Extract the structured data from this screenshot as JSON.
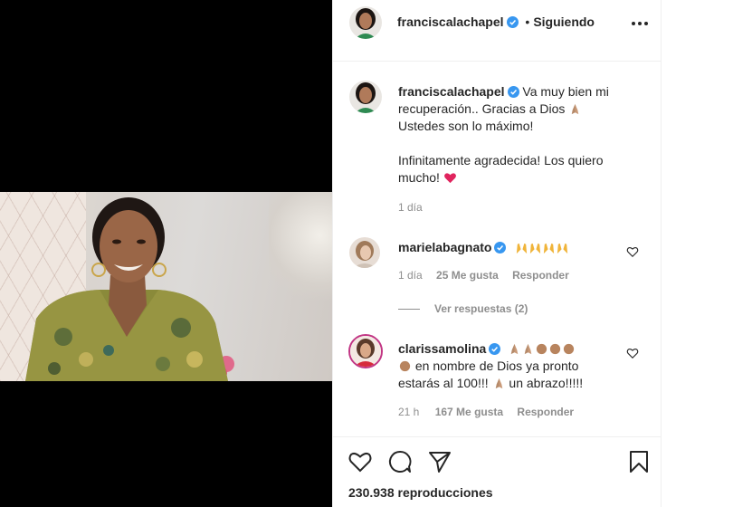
{
  "post": {
    "username": "franciscalachapel",
    "follow_status": "Siguiendo",
    "dot": "•"
  },
  "caption": {
    "username": "franciscalachapel",
    "line1": "Va muy bien mi",
    "line2": "recuperación.. Gracias a Dios",
    "line3": "Ustedes son lo máximo!",
    "line4": "Infinitamente agradecida! Los quiero",
    "line5": "mucho!",
    "time": "1 día"
  },
  "comments": [
    {
      "username": "marielabagnato",
      "time": "1 día",
      "likes": "25 Me gusta",
      "reply": "Responder",
      "view_replies": "Ver respuestas (2)"
    },
    {
      "username": "clarissamolina",
      "line2": "en nombre de Dios ya pronto",
      "line3": "estarás al 100!!!",
      "line3b": "un abrazo!!!!!",
      "time": "21 h",
      "likes": "167 Me gusta",
      "reply": "Responder"
    }
  ],
  "footer": {
    "views": "230.938 reproducciones"
  },
  "colors": {
    "verified": "#3897f0",
    "heart": "#ed4956",
    "text": "#262626",
    "muted": "#8e8e8e"
  }
}
